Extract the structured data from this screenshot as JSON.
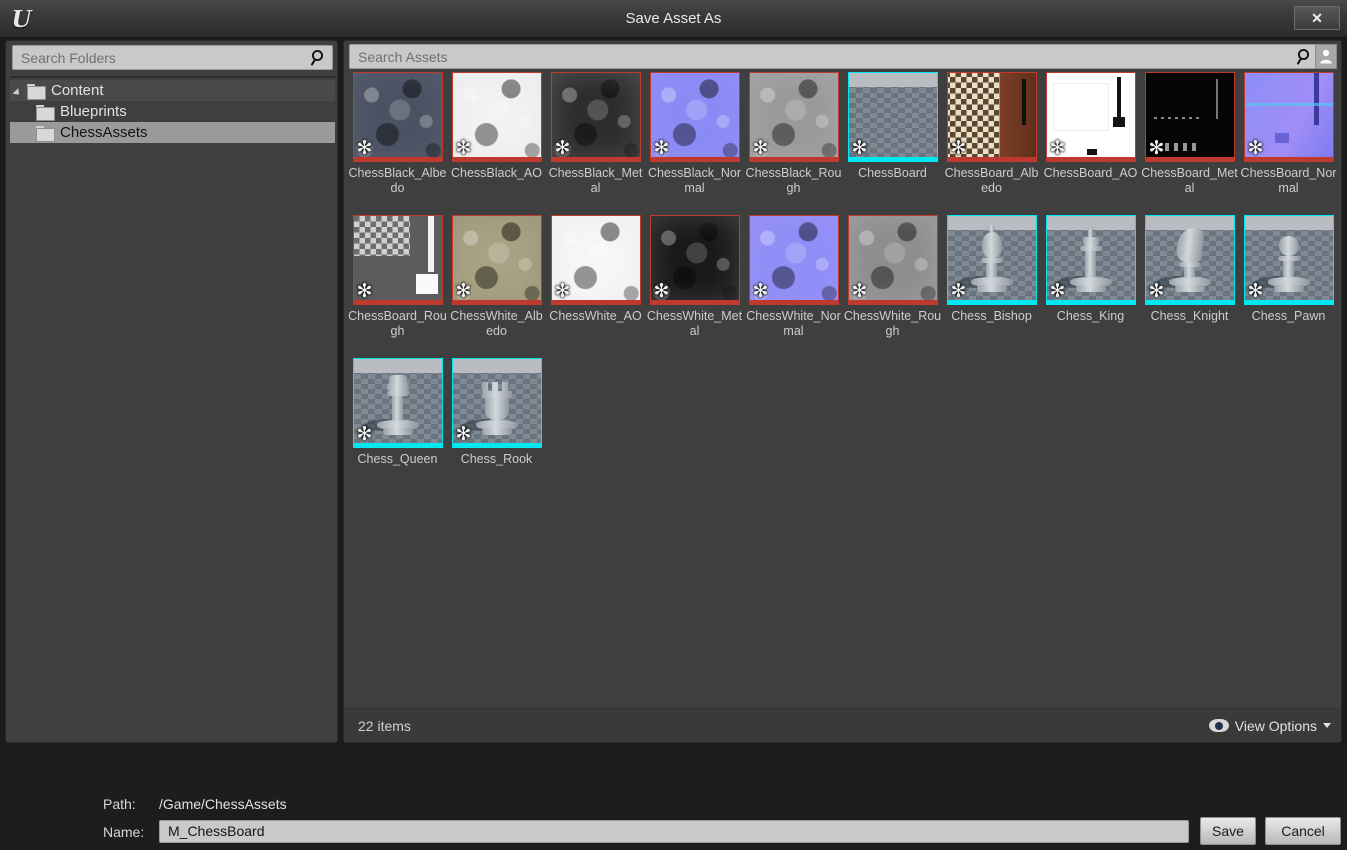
{
  "window": {
    "title": "Save Asset As",
    "logo_icon": "unreal-engine-logo",
    "close_icon": "close-icon",
    "close_label": "✕"
  },
  "folder_panel": {
    "search": {
      "placeholder": "Search Folders",
      "value": "",
      "icon": "search-icon"
    },
    "tree": [
      {
        "label": "Content",
        "level": 0,
        "expanded": true,
        "selected": false
      },
      {
        "label": "Blueprints",
        "level": 1,
        "expanded": false,
        "selected": false
      },
      {
        "label": "ChessAssets",
        "level": 1,
        "expanded": false,
        "selected": true
      }
    ]
  },
  "asset_panel": {
    "search": {
      "placeholder": "Search Assets",
      "value": "",
      "icon": "search-icon"
    },
    "person_icon": "person-filter-icon",
    "status": {
      "items_count": "22 items",
      "view_options_label": "View Options",
      "view_options_icon": "eye-icon",
      "view_options_caret": "chevron-down-icon"
    },
    "colors": {
      "texture_border": "#c0392f",
      "staticmesh_border": "#00e8f0",
      "panel_bg": "#3f3f3f",
      "selection": "#9a9a9a"
    },
    "assets": [
      {
        "name": "ChessBlack_Albedo",
        "type": "texture",
        "overlay_icon": "gear-icon",
        "thumb": "blob",
        "base": "#4b5263",
        "accent": "#8b93a6"
      },
      {
        "name": "ChessBlack_AO",
        "type": "texture",
        "overlay_icon": "gear-icon",
        "thumb": "blob",
        "base": "#f2f2f2",
        "accent": "#cfcfcf"
      },
      {
        "name": "ChessBlack_Metal",
        "type": "texture",
        "overlay_icon": "gear-icon",
        "thumb": "blob",
        "base": "#2d2d2d",
        "accent": "#e8e8e8"
      },
      {
        "name": "ChessBlack_Normal",
        "type": "texture",
        "overlay_icon": "gear-icon",
        "thumb": "blob",
        "base": "#8b8bf5",
        "accent": "#b8a0f8"
      },
      {
        "name": "ChessBlack_Rough",
        "type": "texture",
        "overlay_icon": "gear-icon",
        "thumb": "blob",
        "base": "#9a9a9a",
        "accent": "#e0e0e0"
      },
      {
        "name": "ChessBoard",
        "type": "staticmesh",
        "overlay_icon": "gear-icon",
        "thumb": "mesh-flat",
        "base": "#8d969f",
        "accent": "#b9bcc0"
      },
      {
        "name": "ChessBoard_Albedo",
        "type": "texture",
        "overlay_icon": "gear-icon",
        "thumb": "board",
        "base": "#7d3f26",
        "accent": "#e6ddc4"
      },
      {
        "name": "ChessBoard_AO",
        "type": "texture",
        "overlay_icon": "gear-icon",
        "thumb": "board-ao",
        "base": "#ffffff",
        "accent": "#121212"
      },
      {
        "name": "ChessBoard_Metal",
        "type": "texture",
        "overlay_icon": "gear-icon",
        "thumb": "board-metal",
        "base": "#050505",
        "accent": "#6a6a6a"
      },
      {
        "name": "ChessBoard_Normal",
        "type": "texture",
        "overlay_icon": "gear-icon",
        "thumb": "board-normal",
        "base": "#8b8bf5",
        "accent": "#5a5ad8"
      },
      {
        "name": "ChessBoard_Rough",
        "type": "texture",
        "overlay_icon": "gear-icon",
        "thumb": "board-rough",
        "base": "#5a5a5a",
        "accent": "#dcdcdc"
      },
      {
        "name": "ChessWhite_Albedo",
        "type": "texture",
        "overlay_icon": "gear-icon",
        "thumb": "blob",
        "base": "#a9a284",
        "accent": "#625d46"
      },
      {
        "name": "ChessWhite_AO",
        "type": "texture",
        "overlay_icon": "gear-icon",
        "thumb": "blob",
        "base": "#f6f6f6",
        "accent": "#d4d4d4"
      },
      {
        "name": "ChessWhite_Metal",
        "type": "texture",
        "overlay_icon": "gear-icon",
        "thumb": "blob",
        "base": "#191919",
        "accent": "#f0f0f0"
      },
      {
        "name": "ChessWhite_Normal",
        "type": "texture",
        "overlay_icon": "gear-icon",
        "thumb": "blob",
        "base": "#8f8ff7",
        "accent": "#c79bf5"
      },
      {
        "name": "ChessWhite_Rough",
        "type": "texture",
        "overlay_icon": "gear-icon",
        "thumb": "blob",
        "base": "#8e8e8e",
        "accent": "#ededed"
      },
      {
        "name": "Chess_Bishop",
        "type": "staticmesh",
        "overlay_icon": "gear-icon",
        "thumb": "piece-bishop",
        "base": "#7d868f",
        "accent": "#c8cdd2"
      },
      {
        "name": "Chess_King",
        "type": "staticmesh",
        "overlay_icon": "gear-icon",
        "thumb": "piece-king",
        "base": "#7d868f",
        "accent": "#c8cdd2"
      },
      {
        "name": "Chess_Knight",
        "type": "staticmesh",
        "overlay_icon": "gear-icon",
        "thumb": "piece-knight",
        "base": "#7d868f",
        "accent": "#c8cdd2"
      },
      {
        "name": "Chess_Pawn",
        "type": "staticmesh",
        "overlay_icon": "gear-icon",
        "thumb": "piece-pawn",
        "base": "#7d868f",
        "accent": "#c8cdd2"
      },
      {
        "name": "Chess_Queen",
        "type": "staticmesh",
        "overlay_icon": "gear-icon",
        "thumb": "piece-queen",
        "base": "#7d868f",
        "accent": "#c8cdd2"
      },
      {
        "name": "Chess_Rook",
        "type": "staticmesh",
        "overlay_icon": "gear-icon",
        "thumb": "piece-rook",
        "base": "#7d868f",
        "accent": "#c8cdd2"
      }
    ]
  },
  "footer": {
    "path_label": "Path:",
    "path_value": "/Game/ChessAssets",
    "name_label": "Name:",
    "name_value": "M_ChessBoard",
    "name_placeholder": "",
    "save_label": "Save",
    "cancel_label": "Cancel"
  }
}
